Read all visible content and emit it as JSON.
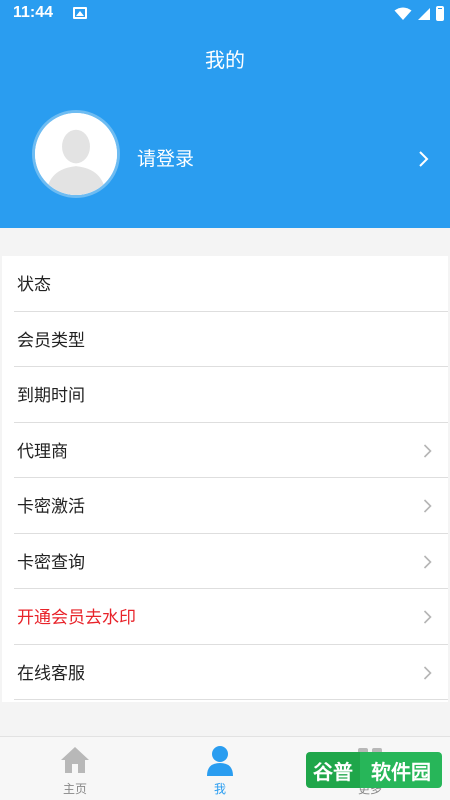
{
  "status_bar": {
    "time": "11:44"
  },
  "header": {
    "title": "我的",
    "login_label": "请登录"
  },
  "menu": {
    "items": [
      {
        "label": "状态",
        "has_arrow": false,
        "color": "#222222"
      },
      {
        "label": "会员类型",
        "has_arrow": false,
        "color": "#222222"
      },
      {
        "label": "到期时间",
        "has_arrow": false,
        "color": "#222222"
      },
      {
        "label": "代理商",
        "has_arrow": true,
        "color": "#222222"
      },
      {
        "label": "卡密激活",
        "has_arrow": true,
        "color": "#222222"
      },
      {
        "label": "卡密查询",
        "has_arrow": true,
        "color": "#222222"
      },
      {
        "label": "开通会员去水印",
        "has_arrow": true,
        "color": "#e8232a"
      },
      {
        "label": "在线客服",
        "has_arrow": true,
        "color": "#222222"
      }
    ]
  },
  "bottom_nav": {
    "items": [
      {
        "label": "主页",
        "icon": "home-icon",
        "active": false
      },
      {
        "label": "我",
        "icon": "person-icon",
        "active": true
      },
      {
        "label": "更多",
        "icon": "more-icon",
        "active": false
      }
    ]
  },
  "watermark": {
    "left": "谷普",
    "right": "软件园"
  },
  "colors": {
    "accent": "#2a9df0",
    "highlight": "#e8232a"
  }
}
